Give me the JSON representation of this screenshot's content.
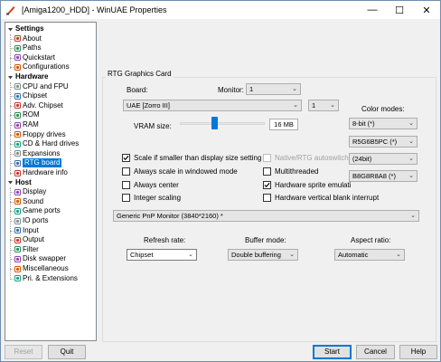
{
  "window": {
    "title": "[Amiga1200_HDD] - WinUAE Properties",
    "minimize": "—",
    "maximize": "☐",
    "close": "✕"
  },
  "tree": {
    "items": [
      {
        "label": "Settings",
        "kind": "category"
      },
      {
        "label": "About",
        "icon": "about-icon"
      },
      {
        "label": "Paths",
        "icon": "paths-icon"
      },
      {
        "label": "Quickstart",
        "icon": "quickstart-icon"
      },
      {
        "label": "Configurations",
        "icon": "configurations-icon"
      },
      {
        "label": "Hardware",
        "kind": "category"
      },
      {
        "label": "CPU and FPU",
        "icon": "cpu-icon"
      },
      {
        "label": "Chipset",
        "icon": "chipset-icon"
      },
      {
        "label": "Adv. Chipset",
        "icon": "adv-chipset-icon"
      },
      {
        "label": "ROM",
        "icon": "rom-icon"
      },
      {
        "label": "RAM",
        "icon": "ram-icon"
      },
      {
        "label": "Floppy drives",
        "icon": "floppy-icon"
      },
      {
        "label": "CD & Hard drives",
        "icon": "hard-drive-icon"
      },
      {
        "label": "Expansions",
        "icon": "expansions-icon"
      },
      {
        "label": "RTG board",
        "icon": "rtg-board-icon",
        "selected": true
      },
      {
        "label": "Hardware info",
        "icon": "hardware-info-icon"
      },
      {
        "label": "Host",
        "kind": "category"
      },
      {
        "label": "Display",
        "icon": "display-icon"
      },
      {
        "label": "Sound",
        "icon": "sound-icon"
      },
      {
        "label": "Game ports",
        "icon": "game-ports-icon"
      },
      {
        "label": "IO ports",
        "icon": "io-ports-icon"
      },
      {
        "label": "Input",
        "icon": "input-icon"
      },
      {
        "label": "Output",
        "icon": "output-icon"
      },
      {
        "label": "Filter",
        "icon": "filter-icon"
      },
      {
        "label": "Disk swapper",
        "icon": "disk-swapper-icon"
      },
      {
        "label": "Miscellaneous",
        "icon": "miscellaneous-icon"
      },
      {
        "label": "Pri. & Extensions",
        "icon": "extensions-icon"
      }
    ]
  },
  "rtg": {
    "group_title": "RTG Graphics Card",
    "board_label": "Board:",
    "monitor_label": "Monitor:",
    "monitor_value": "1",
    "board_value": "UAE [Zorro III]",
    "board_count": "1",
    "vram_label": "VRAM size:",
    "vram_value": "16 MB",
    "vram_level_percent": 40,
    "color_modes_label": "Color modes:",
    "color_modes": [
      "8-bit (*)",
      "R5G6B5PC (*)",
      "(24bit)",
      "B8G8R8A8 (*)"
    ],
    "checkboxes_left": [
      {
        "label": "Scale if smaller than display size setting",
        "checked": true
      },
      {
        "label": "Always scale in windowed mode",
        "checked": false
      },
      {
        "label": "Always center",
        "checked": false
      },
      {
        "label": "Integer scaling",
        "checked": false
      }
    ],
    "checkboxes_right": [
      {
        "label": "Native/RTG autoswitch",
        "checked": false,
        "disabled": true
      },
      {
        "label": "Multithreaded",
        "checked": false
      },
      {
        "label": "Hardware sprite emulati",
        "checked": true
      },
      {
        "label": "Hardware vertical blank interrupt",
        "checked": false
      }
    ],
    "display_device": "Generic PnP Monitor (3840*2160) *",
    "refresh_rate_label": "Refresh rate:",
    "refresh_rate_value": "Chipset",
    "buffer_mode_label": "Buffer mode:",
    "buffer_mode_value": "Double buffering",
    "aspect_ratio_label": "Aspect ratio:",
    "aspect_ratio_value": "Automatic"
  },
  "buttons": {
    "reset": "Reset",
    "quit": "Quit",
    "start": "Start",
    "cancel": "Cancel",
    "help": "Help"
  }
}
